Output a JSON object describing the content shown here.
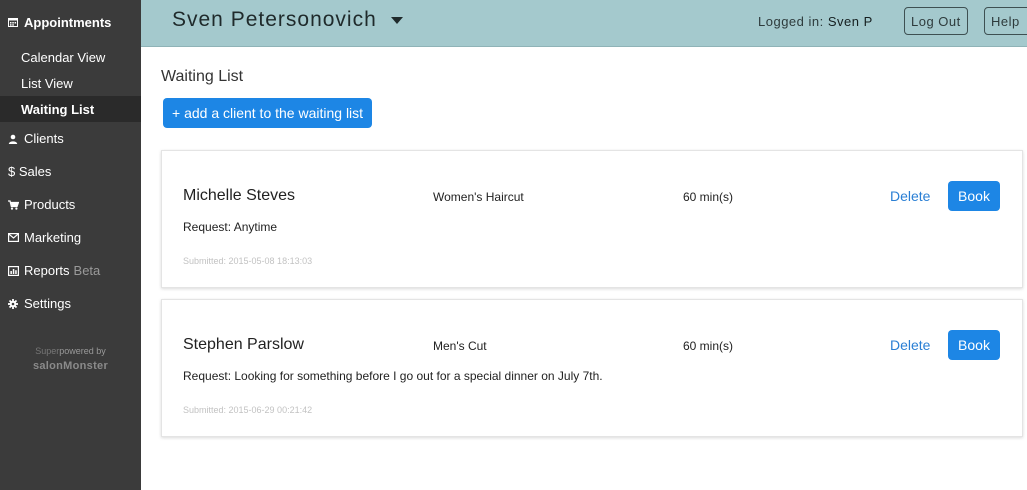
{
  "sidebar": {
    "appointments": "Appointments",
    "sub_items": [
      {
        "label": "Calendar View"
      },
      {
        "label": "List View"
      },
      {
        "label": "Waiting List"
      }
    ],
    "clients": "Clients",
    "sales": "$ Sales",
    "products": "Products",
    "marketing": "Marketing",
    "reports": "Reports",
    "reports_badge": "Beta",
    "settings": "Settings",
    "powered_prefix": "Super",
    "powered_suffix": "powered by",
    "brand": "salonMonster"
  },
  "header": {
    "business_name": "Sven Petersonovich",
    "logged_in_label": "Logged in:",
    "user": "Sven P",
    "logout_label": "Log Out",
    "help_label": "Help",
    "bg_color": "#a4c9cd"
  },
  "main": {
    "title": "Waiting List",
    "add_button": "+ add a client to the waiting list",
    "entries": [
      {
        "name": "Michelle Steves",
        "service": "Women's Haircut",
        "duration": "60 min(s)",
        "request": "Request: Anytime",
        "submitted": "Submitted: 2015-05-08 18:13:03",
        "delete_label": "Delete",
        "book_label": "Book"
      },
      {
        "name": "Stephen Parslow",
        "service": "Men's Cut",
        "duration": "60 min(s)",
        "request": "Request: Looking for something before I go out for a special dinner on July 7th.",
        "submitted": "Submitted: 2015-06-29 00:21:42",
        "delete_label": "Delete",
        "book_label": "Book"
      }
    ]
  },
  "colors": {
    "accent": "#1d86e5",
    "sidebar_bg": "#3b3b3b",
    "link": "#2a7fd4"
  }
}
